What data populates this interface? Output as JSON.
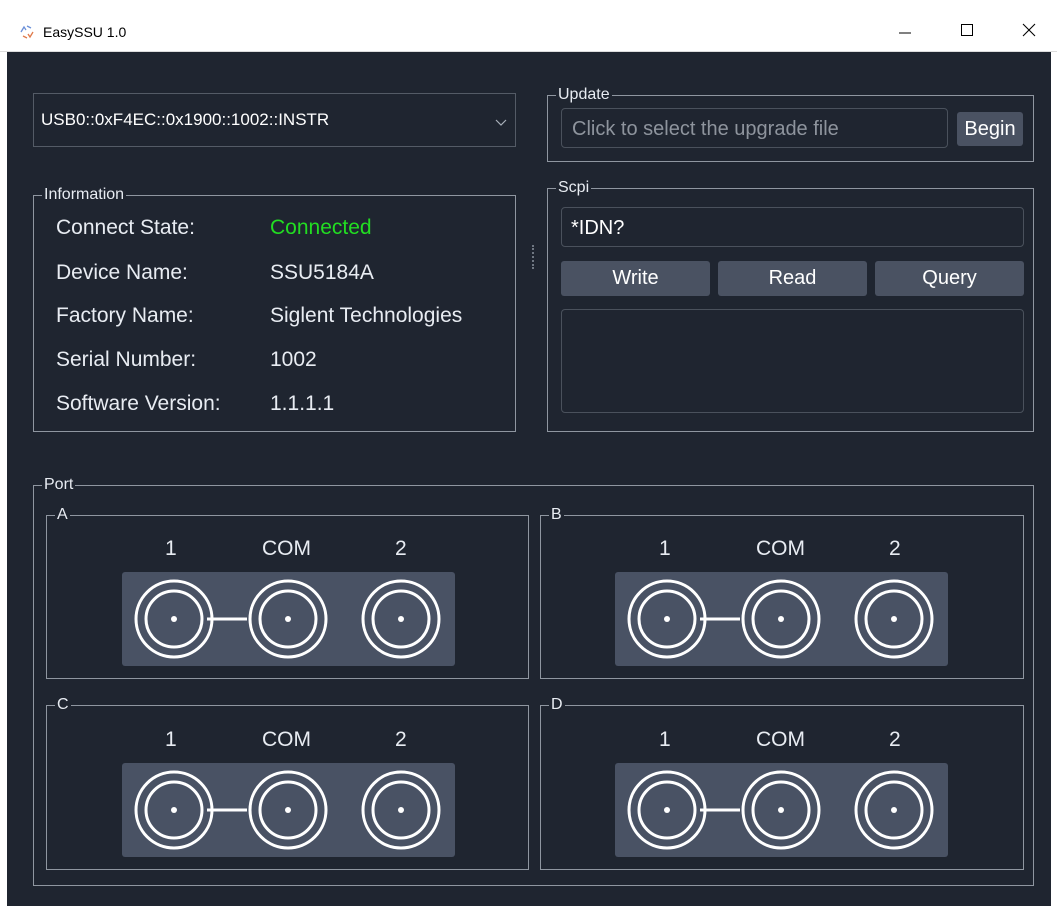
{
  "window": {
    "title": "EasySSU 1.0",
    "icon": "easyssu-app-icon",
    "controls": [
      "minimize-icon",
      "maximize-icon",
      "close-icon"
    ]
  },
  "device_select": {
    "value": "USB0::0xF4EC::0x1900::1002::INSTR",
    "icon": "chevron-down-icon"
  },
  "information": {
    "legend": "Information",
    "rows": [
      {
        "label": "Connect State:",
        "value": "Connected"
      },
      {
        "label": "Device Name:",
        "value": "SSU5184A"
      },
      {
        "label": "Factory Name:",
        "value": "Siglent Technologies"
      },
      {
        "label": "Serial Number:",
        "value": "1002"
      },
      {
        "label": "Software Version:",
        "value": "1.1.1.1"
      }
    ]
  },
  "update": {
    "legend": "Update",
    "file_placeholder": "Click to select the upgrade file",
    "begin_label": "Begin"
  },
  "scpi": {
    "legend": "Scpi",
    "command": "*IDN?",
    "write_label": "Write",
    "read_label": "Read",
    "query_label": "Query",
    "response": ""
  },
  "port": {
    "legend": "Port",
    "groups": [
      {
        "name": "A",
        "labels": [
          "1",
          "COM",
          "2"
        ]
      },
      {
        "name": "B",
        "labels": [
          "1",
          "COM",
          "2"
        ]
      },
      {
        "name": "C",
        "labels": [
          "1",
          "COM",
          "2"
        ]
      },
      {
        "name": "D",
        "labels": [
          "1",
          "COM",
          "2"
        ]
      }
    ]
  },
  "colors": {
    "background": "#1f2530",
    "border": "#8f96a0",
    "button": "#4a5262",
    "connected": "#22dd22",
    "text": "#e8ecf2"
  }
}
